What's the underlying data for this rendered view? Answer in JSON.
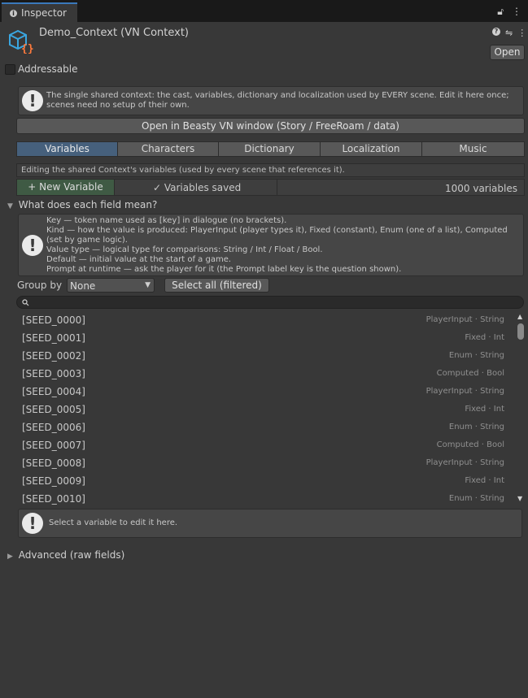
{
  "window": {
    "tab_label": "Inspector",
    "lock_icon": "lock-icon",
    "menu_icon": "kebab-menu-icon"
  },
  "header": {
    "title": "Demo_Context (VN Context)",
    "open_button": "Open",
    "help_icon": "help-icon",
    "settings_icon": "preset-sliders-icon",
    "menu_icon": "kebab-menu-icon",
    "addressable_label": "Addressable"
  },
  "info_box": {
    "text": "The single shared context: the cast, variables, dictionary and localization used by EVERY scene. Edit it here once; scenes need no setup of their own."
  },
  "open_window_button": "Open in Beasty VN window (Story / FreeRoam / data)",
  "tabs": [
    {
      "label": "Variables",
      "active": true
    },
    {
      "label": "Characters",
      "active": false
    },
    {
      "label": "Dictionary",
      "active": false
    },
    {
      "label": "Localization",
      "active": false
    },
    {
      "label": "Music",
      "active": false
    }
  ],
  "editing_note": "Editing the shared Context's variables (used by every scene that references it).",
  "toolbar": {
    "new_variable": "+ New Variable",
    "saved_status": "✓ Variables saved",
    "count": "1000 variables"
  },
  "field_help": {
    "title": "What does each field mean?",
    "lines": [
      "Key — token name used as [key] in dialogue (no brackets).",
      "Kind — how the value is produced: PlayerInput (player types it), Fixed (constant), Enum (one of a list), Computed (set by game logic).",
      "Value type — logical type for comparisons: String / Int / Float / Bool.",
      "Default — initial value at the start of a game.",
      "Prompt at runtime — ask the player for it (the Prompt label key is the question shown)."
    ]
  },
  "filter": {
    "group_by_label": "Group by",
    "group_by_value": "None",
    "select_all": "Select all (filtered)",
    "search_value": ""
  },
  "variables": [
    {
      "key": "[SEED_0000]",
      "meta": "PlayerInput · String"
    },
    {
      "key": "[SEED_0001]",
      "meta": "Fixed · Int"
    },
    {
      "key": "[SEED_0002]",
      "meta": "Enum · String"
    },
    {
      "key": "[SEED_0003]",
      "meta": "Computed · Bool"
    },
    {
      "key": "[SEED_0004]",
      "meta": "PlayerInput · String"
    },
    {
      "key": "[SEED_0005]",
      "meta": "Fixed · Int"
    },
    {
      "key": "[SEED_0006]",
      "meta": "Enum · String"
    },
    {
      "key": "[SEED_0007]",
      "meta": "Computed · Bool"
    },
    {
      "key": "[SEED_0008]",
      "meta": "PlayerInput · String"
    },
    {
      "key": "[SEED_0009]",
      "meta": "Fixed · Int"
    },
    {
      "key": "[SEED_0010]",
      "meta": "Enum · String"
    }
  ],
  "select_hint": "Select a variable to edit it here.",
  "advanced_label": "Advanced (raw fields)"
}
